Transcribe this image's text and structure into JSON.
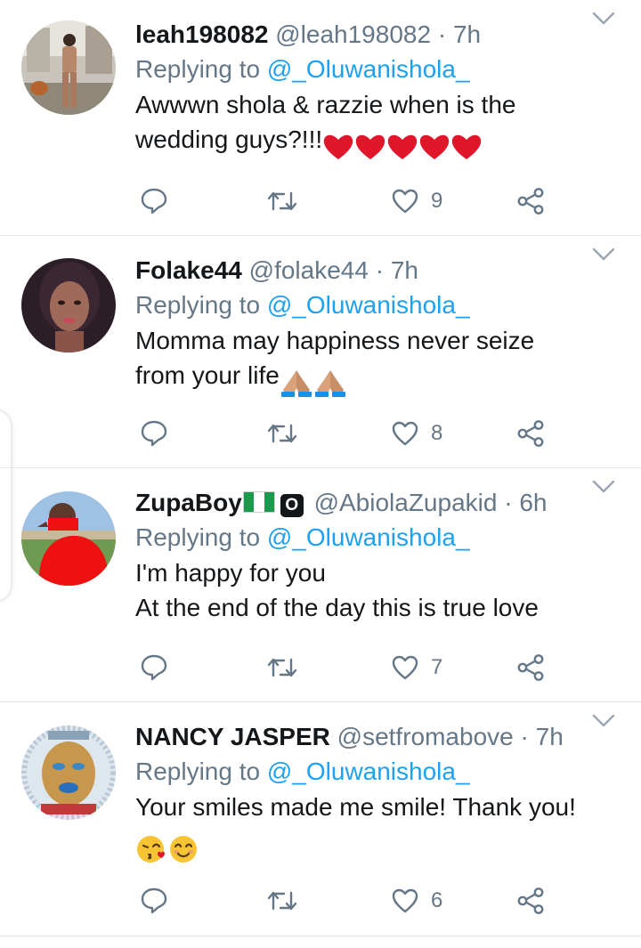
{
  "colors": {
    "text": "#14171a",
    "muted": "#657786",
    "link": "#1da1f2",
    "divider": "#e1e8ed"
  },
  "tweets": [
    {
      "name": "leah198082",
      "handle": "@leah198082",
      "dot": "·",
      "time": "7h",
      "replying_label": "Replying to",
      "replying_to": "@_Oluwanishola_",
      "text": "Awwwn shola & razzie when is the\nwedding guys?!!!",
      "emojis": [
        "red-heart",
        "red-heart",
        "red-heart",
        "red-heart",
        "red-heart"
      ],
      "likes": "9"
    },
    {
      "name": "Folake44",
      "handle": "@folake44",
      "dot": "·",
      "time": "7h",
      "replying_label": "Replying to",
      "replying_to": "@_Oluwanishola_",
      "text": "Momma may happiness never seize\nfrom your life",
      "emojis": [
        "folded-hands",
        "folded-hands"
      ],
      "likes": "8"
    },
    {
      "name": "ZupaBoy",
      "name_icons": [
        "nigeria-flag-icon",
        "O"
      ],
      "handle": "@AbiolaZupakid",
      "dot": "·",
      "time": "6h",
      "replying_label": "Replying to",
      "replying_to": "@_Oluwanishola_",
      "text": "I'm happy for you\nAt the end of the day this is true love",
      "likes": "7"
    },
    {
      "name": "NANCY JASPER",
      "handle": "@setfromabove",
      "dot": "·",
      "time": "7h",
      "replying_label": "Replying to",
      "replying_to": "@_Oluwanishola_",
      "text": "Your smiles made me smile! Thank you!",
      "emojis": [
        "kissing-face",
        "smiling-face"
      ],
      "likes": "6"
    }
  ]
}
